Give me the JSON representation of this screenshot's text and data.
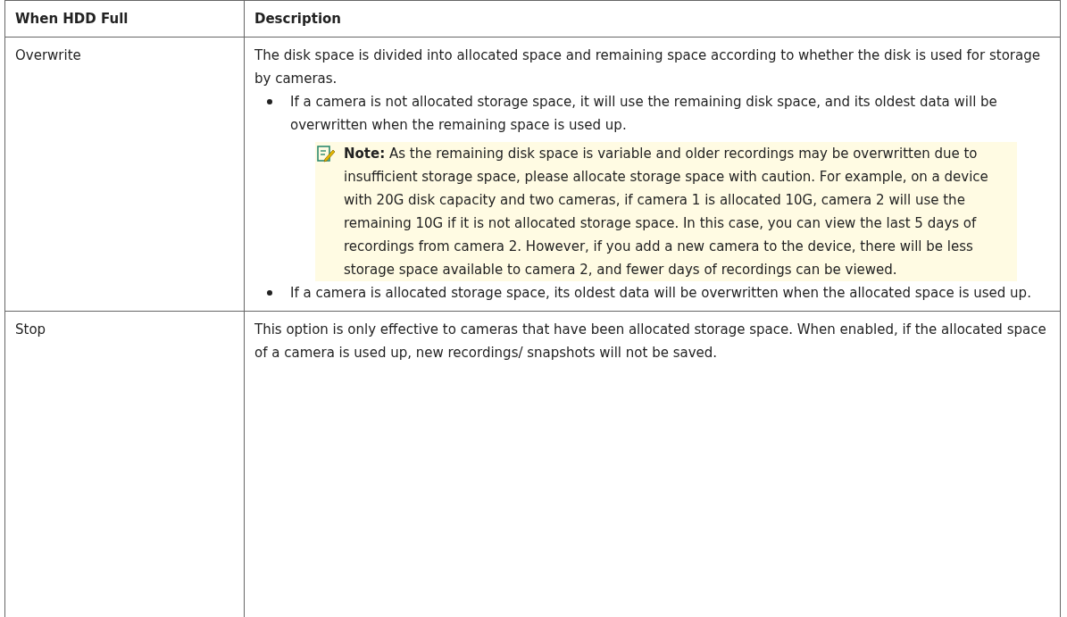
{
  "table": {
    "columns": [
      "When HDD Full",
      "Description"
    ],
    "rows": [
      {
        "option": "Overwrite",
        "description": "The disk space is divided into allocated space and remaining space according to whether the disk is used for storage by cameras.",
        "bullets": [
          {
            "text": "If a camera is not allocated storage space, it will use the remaining disk space, and its oldest data will be overwritten when the remaining space is used up.",
            "note": "**Note:**  As the remaining disk space is variable and older recordings may be overwritten due to insufficient storage space, please allocate storage space with caution. For example, on a device with 20G disk capacity and two cameras, if camera 1 is allocated 10G, camera 2 will use the remaining 10G if it is not allocated storage space. In this case, you can view the last 5 days of recordings from camera 2. However, if you add a new camera to the device, there will be less storage space available to camera 2, and fewer days of recordings can be viewed."
          },
          {
            "text": "If a camera is allocated storage space, its oldest data will be overwritten when the allocated space is used up."
          }
        ]
      },
      {
        "option": "Stop",
        "description": "This option is only effective to cameras that have been allocated storage space. When enabled, if the allocated space of a camera is used up, new recordings/ snapshots will not be saved."
      }
    ]
  }
}
